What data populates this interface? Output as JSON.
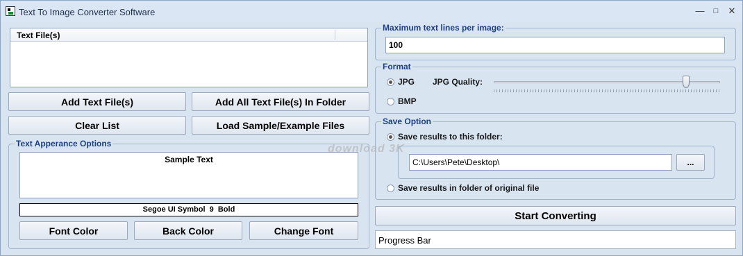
{
  "window": {
    "title": "Text To Image Converter Software",
    "controls": {
      "minimize": "—",
      "maximize": "□",
      "close": "✕"
    }
  },
  "files": {
    "column_header": "Text File(s)",
    "rows": []
  },
  "buttons": {
    "add_files": "Add Text File(s)",
    "add_folder": "Add All Text File(s) In Folder",
    "clear_list": "Clear List",
    "load_sample": "Load Sample/Example Files",
    "font_color": "Font Color",
    "back_color": "Back Color",
    "change_font": "Change Font",
    "browse": "...",
    "start": "Start Converting"
  },
  "appearance": {
    "legend": "Text Apperance Options",
    "sample_text": "Sample Text",
    "font_description": "Segoe UI Symbol  9  Bold"
  },
  "max_lines": {
    "legend": "Maximum text lines per image:",
    "value": "100"
  },
  "format": {
    "legend": "Format",
    "jpg_label": "JPG",
    "bmp_label": "BMP",
    "selected": "JPG",
    "quality_label": "JPG Quality:",
    "quality_fraction": 0.85
  },
  "save_option": {
    "legend": "Save Option",
    "folder_option_label": "Save results to this folder:",
    "folder_path": "C:\\Users\\Pete\\Desktop\\",
    "original_option_label": "Save results in folder of original file",
    "selected": "folder"
  },
  "progress": {
    "label": "Progress Bar"
  },
  "watermark": "download 3K",
  "colors": {
    "background": "#d9e4f1",
    "legend": "#1c3f8a",
    "border": "#9fb3cd"
  }
}
